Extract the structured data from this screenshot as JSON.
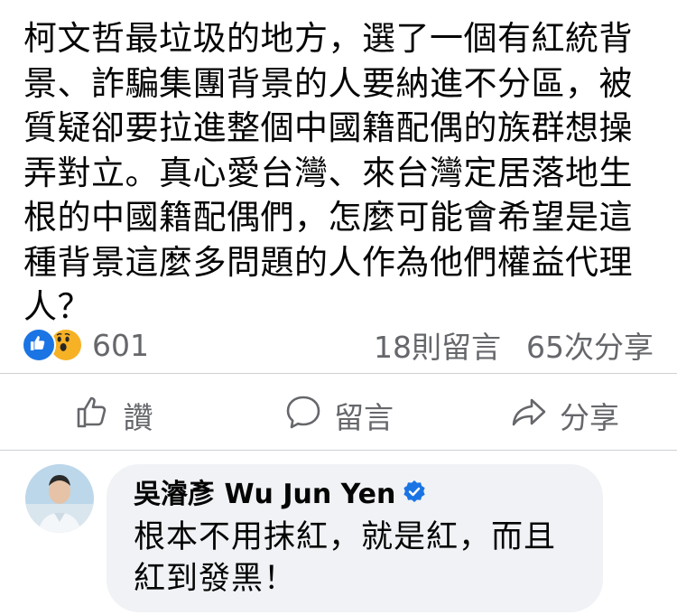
{
  "post": {
    "lines": [
      "柯文哲最垃圾的地方，選了一個有紅統背",
      "景、詐騙集團背景的人要納進不分區，被",
      "質疑卻要拉進整個中國籍配偶的族群想操",
      "弄對立。真心愛台灣、來台灣定居落地生",
      "根的中國籍配偶們，怎麼可能會希望是這",
      "種背景這麼多問題的人作為他們權益代理",
      "人？"
    ]
  },
  "stats": {
    "reaction_count": "601",
    "comments": "18則留言",
    "shares": "65次分享"
  },
  "actions": {
    "like": "讚",
    "comment": "留言",
    "share": "分享"
  },
  "comment": {
    "author": "吳濬彥 Wu Jun Yen",
    "lines": [
      "根本不用抹紅，就是紅，而且",
      "紅到發黑！"
    ]
  },
  "colors": {
    "like_blue": "#1b74e4",
    "wow_yellow": "#f7b125",
    "secondary_text": "#65676b",
    "bubble_bg": "#f0f2f5"
  }
}
